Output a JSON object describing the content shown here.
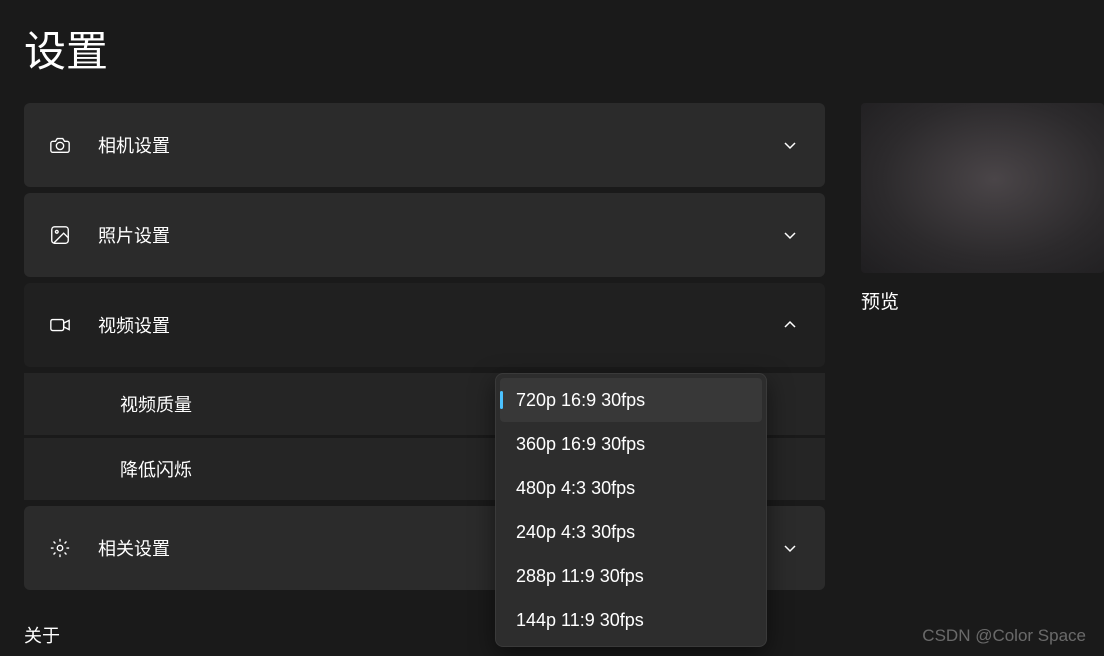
{
  "page_title": "设置",
  "sections": {
    "camera": {
      "label": "相机设置",
      "expanded": false
    },
    "photo": {
      "label": "照片设置",
      "expanded": false
    },
    "video": {
      "label": "视频设置",
      "expanded": true,
      "quality_label": "视频质量",
      "flicker_label": "降低闪烁"
    },
    "related": {
      "label": "相关设置",
      "expanded": false
    }
  },
  "video_quality_options": [
    "720p 16:9 30fps",
    "360p 16:9 30fps",
    "480p 4:3 30fps",
    "240p 4:3 30fps",
    "288p 11:9 30fps",
    "144p 11:9 30fps"
  ],
  "video_quality_selected_index": 0,
  "preview_label": "预览",
  "about_label": "关于",
  "watermark": "CSDN @Color Space"
}
